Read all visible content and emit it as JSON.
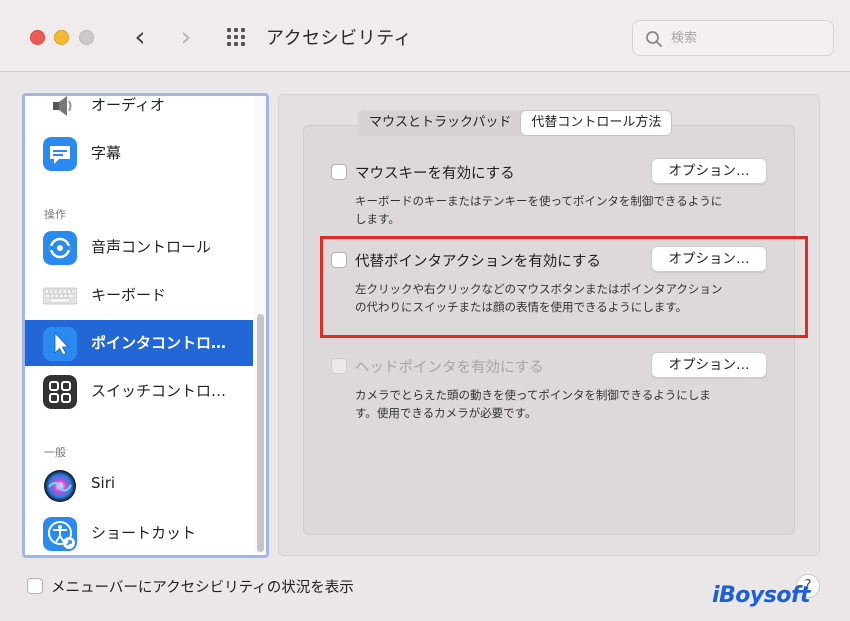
{
  "window": {
    "title": "アクセシビリティ",
    "search_placeholder": "検索"
  },
  "sidebar": {
    "items": [
      {
        "label": "オーディオ",
        "icon": "speaker-icon"
      },
      {
        "label": "字幕",
        "icon": "captions-icon"
      },
      {
        "label": "音声コントロール",
        "icon": "voice-control-icon"
      },
      {
        "label": "キーボード",
        "icon": "keyboard-icon"
      },
      {
        "label": "ポインタコントロ…",
        "icon": "pointer-icon",
        "selected": true
      },
      {
        "label": "スイッチコントロ…",
        "icon": "switch-control-icon"
      },
      {
        "label": "Siri",
        "icon": "siri-icon"
      },
      {
        "label": "ショートカット",
        "icon": "accessibility-shortcut-icon"
      }
    ],
    "headers": {
      "operation": "操作",
      "general": "一般"
    }
  },
  "tabs": [
    {
      "label": "マウスとトラックパッド",
      "active": false
    },
    {
      "label": "代替コントロール方法",
      "active": true
    }
  ],
  "options": [
    {
      "title": "マウスキーを有効にする",
      "desc": "キーボードのキーまたはテンキーを使ってポインタを制御できるようにします。",
      "button": "オプション…",
      "checked": false,
      "enabled": true
    },
    {
      "title": "代替ポインタアクションを有効にする",
      "desc": "左クリックや右クリックなどのマウスボタンまたはポインタアクションの代わりにスイッチまたは顔の表情を使用できるようにします。",
      "button": "オプション…",
      "checked": false,
      "enabled": true
    },
    {
      "title": "ヘッドポインタを有効にする",
      "desc": "カメラでとらえた頭の動きを使ってポインタを制御できるようにします。使用できるカメラが必要です。",
      "button": "オプション…",
      "checked": false,
      "enabled": false
    }
  ],
  "footer": {
    "show_menubar_label": "メニューバーにアクセシビリティの状況を表示",
    "help_label": "?"
  },
  "watermark": "iBoysoft",
  "colors": {
    "selection": "#2366d5",
    "highlight": "#e12a22",
    "sidebar_border": "#9fb6e8"
  }
}
